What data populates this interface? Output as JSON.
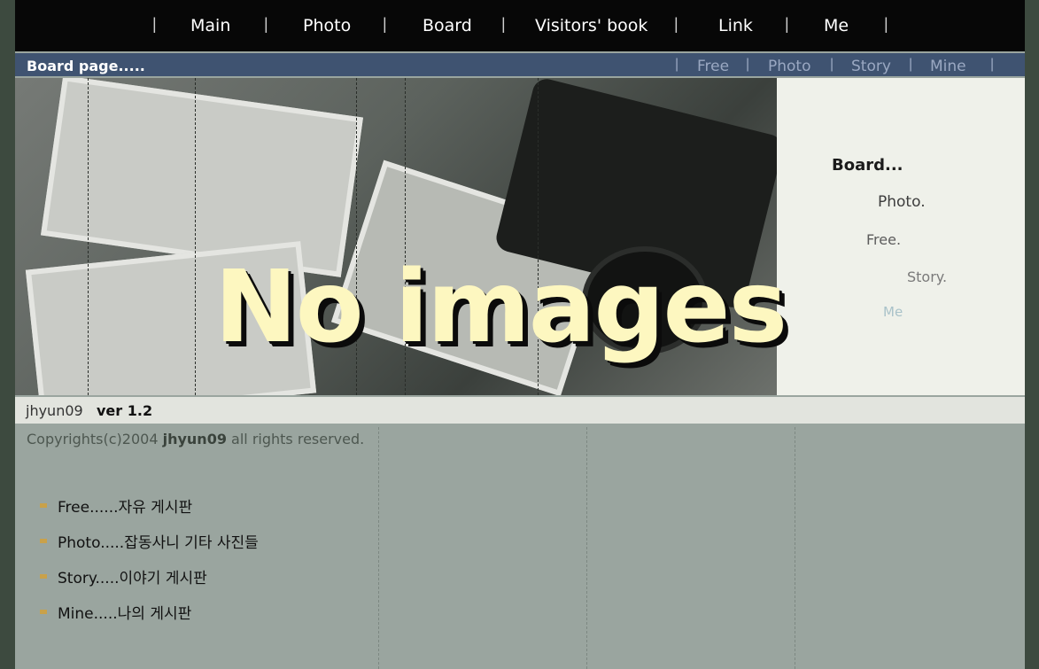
{
  "nav": {
    "items": [
      {
        "key": "main",
        "label": "Main"
      },
      {
        "key": "photo",
        "label": "Photo"
      },
      {
        "key": "board",
        "label": "Board"
      },
      {
        "key": "visitors",
        "label": "Visitors' book"
      },
      {
        "key": "link",
        "label": "Link"
      },
      {
        "key": "me",
        "label": "Me"
      }
    ],
    "separator": "|"
  },
  "subbar": {
    "title": "Board page.....",
    "items": [
      {
        "label": "Free"
      },
      {
        "label": "Photo"
      },
      {
        "label": "Story"
      },
      {
        "label": "Mine"
      }
    ]
  },
  "hero": {
    "overlay_text": "No images",
    "side_menu": [
      {
        "label": "Board...",
        "color": "#1b1b1b"
      },
      {
        "label": "Photo.",
        "color": "#3d3d3d"
      },
      {
        "label": "Free.",
        "color": "#5c5c5c"
      },
      {
        "label": "Story.",
        "color": "#7a7a7a"
      },
      {
        "label": "Me",
        "color": "#a9c2c9"
      }
    ]
  },
  "footer": {
    "site_name": "jhyun09",
    "version": "ver 1.2",
    "copyright_prefix": "Copyrights(c)2004 ",
    "copyright_name": "jhyun09",
    "copyright_suffix": " all rights reserved."
  },
  "boards": [
    {
      "label": "Free......자유 게시판"
    },
    {
      "label": "Photo.....잡동사니 기타 사진들"
    },
    {
      "label": "Story.....이야기 게시판"
    },
    {
      "label": "Mine.....나의 게시판"
    }
  ],
  "colors": {
    "nav_bg": "#070707",
    "subbar_bg": "#3f5371",
    "content_bg": "#9aa59f",
    "overlay_text": "#fdf7c0"
  }
}
